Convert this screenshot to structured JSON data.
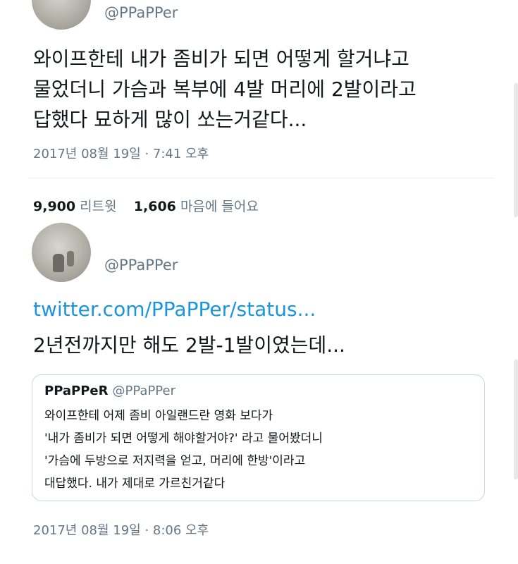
{
  "tweet1": {
    "handle": "@PPaPPer",
    "lines": [
      "와이프한테 내가 좀비가 되면 어떻게 할거냐고",
      "물었더니 가슴과 복부에 4발 머리에 2발이라고",
      "답했다 묘하게 많이 쏘는거같다..."
    ],
    "timestamp": "2017년 08월 19일 · 7:41 오후",
    "retweet_count": "9,900",
    "retweet_label": "리트윗",
    "like_count": "1,606",
    "like_label": "마음에 들어요"
  },
  "tweet2": {
    "handle": "@PPaPPer",
    "link": "twitter.com/PPaPPer/status...",
    "text": "2년전까지만 해도 2발-1발이였는데...",
    "quote": {
      "name": "PPaPPeR",
      "handle": "@PPaPPer",
      "lines": [
        "와이프한테 어제 좀비 아일랜드란 영화 보다가",
        "'내가 좀비가 되면 어떻게 해야할거야?' 라고 물어봤더니",
        "'가슴에 두방으로 저지력을 얻고, 머리에 한방'이라고",
        "대답했다. 내가 제대로 가르친거같다"
      ]
    },
    "timestamp": "2017년 08월 19일 · 8:06 오후"
  },
  "colors": {
    "text": "#14171a",
    "secondary": "#657786",
    "link": "#1b95e0",
    "border": "#ccd6dd"
  }
}
